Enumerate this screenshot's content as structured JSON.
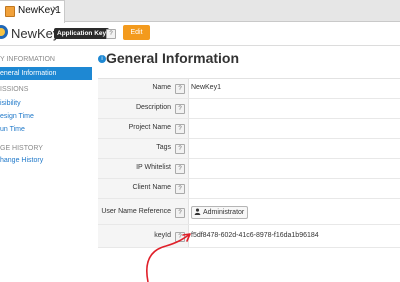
{
  "tab": {
    "label": "NewKey1",
    "close": "×"
  },
  "header": {
    "name": "NewKey1",
    "badge": "Application Key",
    "help": "?",
    "edit": "Edit"
  },
  "sidebar": {
    "sections": [
      {
        "title": "Y INFORMATION",
        "items": [
          {
            "label": "eneral Information",
            "active": true
          }
        ]
      },
      {
        "title": "ISSIONS",
        "items": [
          {
            "label": "isibility"
          },
          {
            "label": "esign Time"
          },
          {
            "label": "un Time"
          }
        ]
      },
      {
        "title": "GE HISTORY",
        "items": [
          {
            "label": "hange History"
          }
        ]
      }
    ]
  },
  "main": {
    "title": "General Information",
    "title_icon": "i",
    "fields": [
      {
        "label": "Name",
        "value": "NewKey1"
      },
      {
        "label": "Description",
        "value": ""
      },
      {
        "label": "Project Name",
        "value": ""
      },
      {
        "label": "Tags",
        "value": ""
      },
      {
        "label": "IP Whitelist",
        "value": ""
      },
      {
        "label": "Client Name",
        "value": ""
      },
      {
        "label": "User Name Reference",
        "button": "Administrator"
      },
      {
        "label": "keyId",
        "value": "f5df8478-602d-41c6-8978-f16da1b96184"
      }
    ]
  },
  "colors": {
    "accent": "#1e88d3",
    "edit": "#f39a1d",
    "annotation": "#e0202a"
  }
}
